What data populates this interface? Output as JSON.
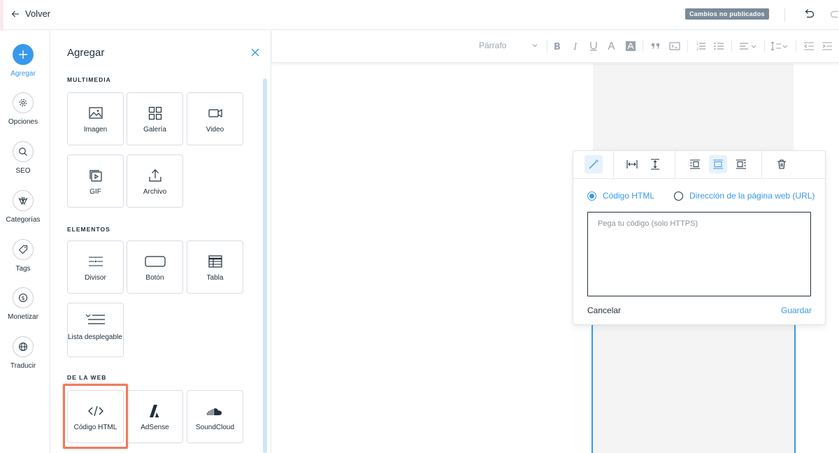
{
  "header": {
    "back_label": "Volver",
    "status_badge": "Cambios no publicados"
  },
  "rail": {
    "items": [
      {
        "label": "Agregar",
        "icon": "plus-icon"
      },
      {
        "label": "Opciones",
        "icon": "gear-icon"
      },
      {
        "label": "SEO",
        "icon": "search-icon"
      },
      {
        "label": "Categorías",
        "icon": "categories-icon"
      },
      {
        "label": "Tags",
        "icon": "tag-icon"
      },
      {
        "label": "Monetizar",
        "icon": "dollar-icon"
      },
      {
        "label": "Traducir",
        "icon": "globe-icon"
      }
    ]
  },
  "panel": {
    "title": "Agregar",
    "sections": {
      "multimedia": "MULTIMEDIA",
      "elements": "ELEMENTOS",
      "web": "DE LA WEB"
    },
    "tiles": {
      "image": "Imagen",
      "gallery": "Galería",
      "video": "Video",
      "gif": "GIF",
      "file": "Archivo",
      "divider": "Divisor",
      "button": "Botón",
      "table": "Tabla",
      "dropdown": "Lista desplegable",
      "html_code": "Código HTML",
      "adsense": "AdSense",
      "soundcloud": "SoundCloud"
    }
  },
  "toolbar": {
    "paragraph_select": "Párrafo"
  },
  "html_popup": {
    "option_html": "Código HTML",
    "option_url": "Dirección de la página web (URL)",
    "selected_option": "Código HTML",
    "placeholder": "Pega tu código (solo HTTPS)",
    "cancel_label": "Cancelar",
    "save_label": "Guardar"
  },
  "colors": {
    "accent": "#3899ec",
    "highlight": "#f07b5f",
    "badge": "#7a8a99"
  }
}
